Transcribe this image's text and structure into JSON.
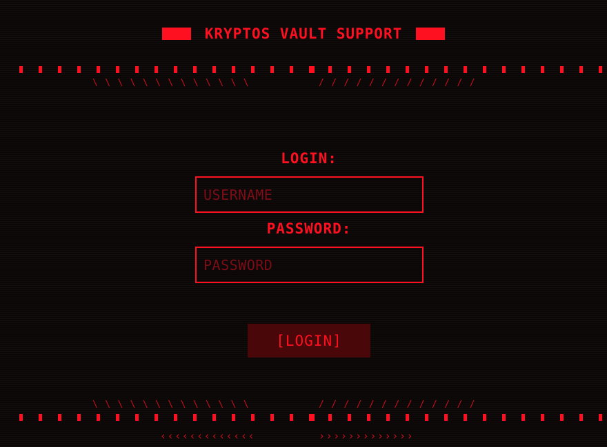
{
  "header": {
    "title": "KRYPTOS VAULT SUPPORT"
  },
  "decor": {
    "slashes_left": "\\\\\\\\\\\\\\\\\\\\\\\\\\",
    "slashes_right": "/////////////",
    "arrows_left": "‹‹‹‹‹‹‹‹‹‹‹‹‹",
    "arrows_right": "›››››››››››››"
  },
  "form": {
    "login_label": "LOGIN:",
    "username_placeholder": "USERNAME",
    "password_label": "PASSWORD:",
    "password_placeholder": "PASSWORD",
    "submit_label": "[LOGIN]"
  },
  "colors": {
    "accent": "#ff1020",
    "background": "#0b0707",
    "button_bg": "#4a0709",
    "placeholder": "#7c0c16"
  }
}
